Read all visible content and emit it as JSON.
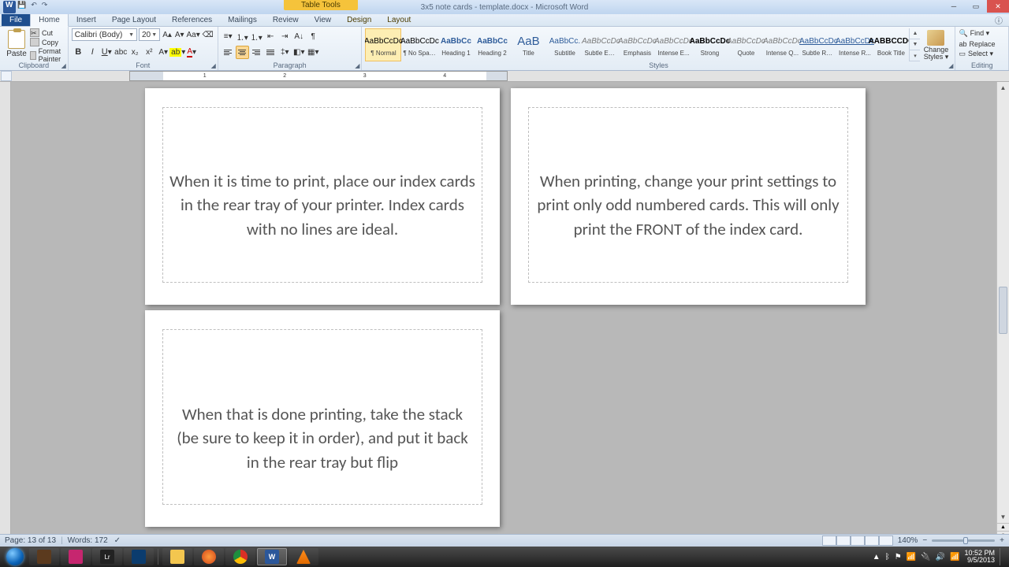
{
  "title": {
    "context_tab": "Table Tools",
    "doc": "3x5 note cards - template.docx - Microsoft Word"
  },
  "tabs": {
    "file": "File",
    "items": [
      "Home",
      "Insert",
      "Page Layout",
      "References",
      "Mailings",
      "Review",
      "View"
    ],
    "ctx": [
      "Design",
      "Layout"
    ]
  },
  "ribbon": {
    "clipboard": {
      "label": "Clipboard",
      "paste": "Paste",
      "cut": "Cut",
      "copy": "Copy",
      "fmt": "Format Painter"
    },
    "font": {
      "label": "Font",
      "name": "Calibri (Body)",
      "size": "20"
    },
    "paragraph": {
      "label": "Paragraph"
    },
    "styles": {
      "label": "Styles",
      "change": "Change Styles ▾",
      "items": [
        {
          "prev": "AaBbCcDc",
          "cls": "",
          "name": "¶ Normal"
        },
        {
          "prev": "AaBbCcDc",
          "cls": "",
          "name": "¶ No Spaci..."
        },
        {
          "prev": "AaBbCc",
          "cls": "blue bold",
          "name": "Heading 1"
        },
        {
          "prev": "AaBbCc",
          "cls": "blue bold",
          "name": "Heading 2"
        },
        {
          "prev": "AaB",
          "cls": "big",
          "name": "Title"
        },
        {
          "prev": "AaBbCc.",
          "cls": "blue",
          "name": "Subtitle"
        },
        {
          "prev": "AaBbCcDc",
          "cls": "gray",
          "name": "Subtle Em..."
        },
        {
          "prev": "AaBbCcDc",
          "cls": "gray",
          "name": "Emphasis"
        },
        {
          "prev": "AaBbCcDc",
          "cls": "gray",
          "name": "Intense E..."
        },
        {
          "prev": "AaBbCcDc",
          "cls": "bold",
          "name": "Strong"
        },
        {
          "prev": "AaBbCcDc",
          "cls": "gray",
          "name": "Quote"
        },
        {
          "prev": "AaBbCcDc",
          "cls": "gray",
          "name": "Intense Q..."
        },
        {
          "prev": "AaBbCcDc",
          "cls": "und",
          "name": "Subtle Ref..."
        },
        {
          "prev": "AaBbCcDc",
          "cls": "und",
          "name": "Intense R..."
        },
        {
          "prev": "AABBCCDC",
          "cls": "bold",
          "name": "Book Title"
        }
      ]
    },
    "editing": {
      "label": "Editing",
      "find": "Find ▾",
      "replace": "Replace",
      "select": "Select ▾"
    }
  },
  "ruler": {
    "marks": [
      "",
      "1",
      "",
      "2",
      "",
      "3",
      "",
      "4",
      ""
    ]
  },
  "cards": {
    "c1": "When it is time to print, place our index cards in the rear tray of your printer.  Index cards with no lines are ideal.",
    "c2": "When printing, change your print settings to print only odd numbered cards.  This will only print the FRONT of the index card.",
    "c3": "When that is done printing, take the stack (be sure to keep it in order), and put it back in the rear tray but flip"
  },
  "status": {
    "page": "Page: 13 of 13",
    "words": "Words: 172",
    "zoom": "140%"
  },
  "tray": {
    "time": "10:52 PM",
    "date": "9/5/2013"
  }
}
